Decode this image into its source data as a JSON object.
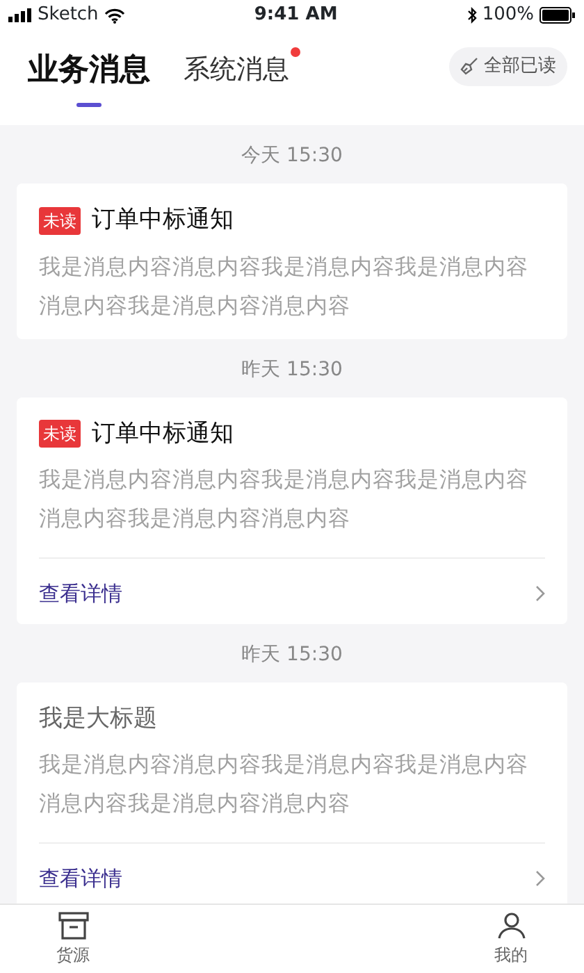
{
  "status_bar": {
    "carrier": "Sketch",
    "time": "9:41 AM",
    "battery": "100%"
  },
  "tabs": [
    {
      "label": "业务消息",
      "selected": true,
      "has_dot": false
    },
    {
      "label": "系统消息",
      "selected": false,
      "has_dot": true
    }
  ],
  "mark_all_read": "全部已读",
  "groups": [
    {
      "date": "今天 15:30",
      "message": {
        "unread": true,
        "badge": "未读",
        "title": "订单中标通知",
        "content": "我是消息内容消息内容我是消息内容我是消息内容消息内容我是消息内容消息内容"
      }
    },
    {
      "date": "昨天 15:30",
      "message": {
        "unread": true,
        "badge": "未读",
        "title": "订单中标通知",
        "content": "我是消息内容消息内容我是消息内容我是消息内容消息内容我是消息内容消息内容",
        "link": "查看详情"
      }
    },
    {
      "date": "昨天 15:30",
      "message": {
        "unread": false,
        "title": "我是大标题",
        "content": "我是消息内容消息内容我是消息内容我是消息内容消息内容我是消息内容消息内容",
        "link": "查看详情"
      }
    }
  ],
  "tab_bar": [
    {
      "kind": "box",
      "label": "货源"
    },
    {
      "kind": "person",
      "label": "我的"
    }
  ]
}
